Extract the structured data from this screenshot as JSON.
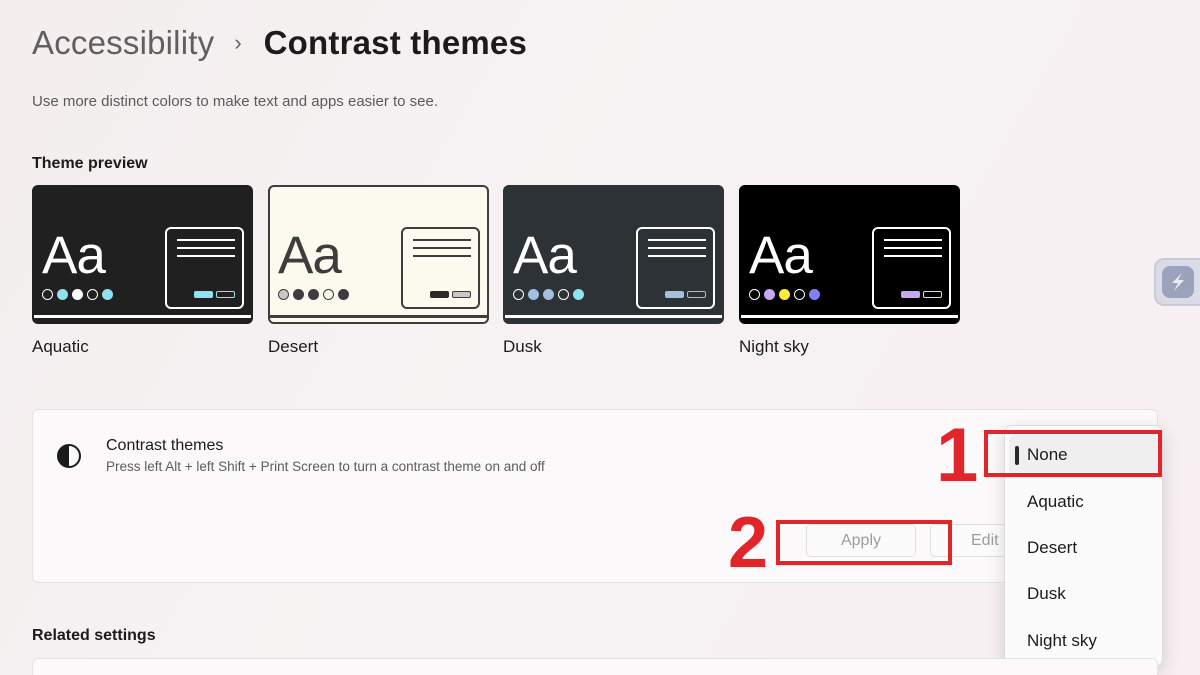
{
  "breadcrumb": {
    "parent": "Accessibility",
    "separator": "›",
    "current": "Contrast themes"
  },
  "subtitle": "Use more distinct colors to make text and apps easier to see.",
  "theme_preview": {
    "label": "Theme preview",
    "preview_text": "Aa",
    "themes": [
      {
        "name": "Aquatic",
        "bg": "#202020",
        "text": "#ffffff",
        "line": "#ffffff",
        "dots": [
          "#202020",
          "#8ee3f0",
          "#ffffff",
          "#202020",
          "#8ee3f0"
        ],
        "mini": [
          "#8ee3f0",
          "#202020"
        ]
      },
      {
        "name": "Desert",
        "bg": "#fcf9ef",
        "text": "#3d3d3d",
        "line": "#3d3d3d",
        "dots": [
          "#c7c7c7",
          "#3d3d3d",
          "#3d3d3d",
          "#fcf9ef",
          "#3d3d3d"
        ],
        "mini": [
          "#2b2b2b",
          "#c7c7c7"
        ]
      },
      {
        "name": "Dusk",
        "bg": "#2d3236",
        "text": "#ffffff",
        "line": "#ffffff",
        "dots": [
          "#2d3236",
          "#a1bfde",
          "#a1bfde",
          "#2d3236",
          "#8ee3f0"
        ],
        "mini": [
          "#a1bfde",
          "#2d3236"
        ]
      },
      {
        "name": "Night sky",
        "bg": "#000000",
        "text": "#ffffff",
        "line": "#ffffff",
        "dots": [
          "#000000",
          "#c7a6f5",
          "#ffee32",
          "#000000",
          "#8080ff"
        ],
        "mini": [
          "#c7a6f5",
          "#000000"
        ]
      }
    ]
  },
  "contrast_setting": {
    "title": "Contrast themes",
    "description": "Press left Alt + left Shift + Print Screen to turn a contrast theme on and off",
    "apply_label": "Apply",
    "edit_label": "Edit",
    "selected": "None"
  },
  "dropdown": {
    "options": [
      "None",
      "Aquatic",
      "Desert",
      "Dusk",
      "Night sky"
    ]
  },
  "annotations": {
    "one": "1",
    "two": "2",
    "color": "#e0262b"
  },
  "related": {
    "label": "Related settings"
  }
}
